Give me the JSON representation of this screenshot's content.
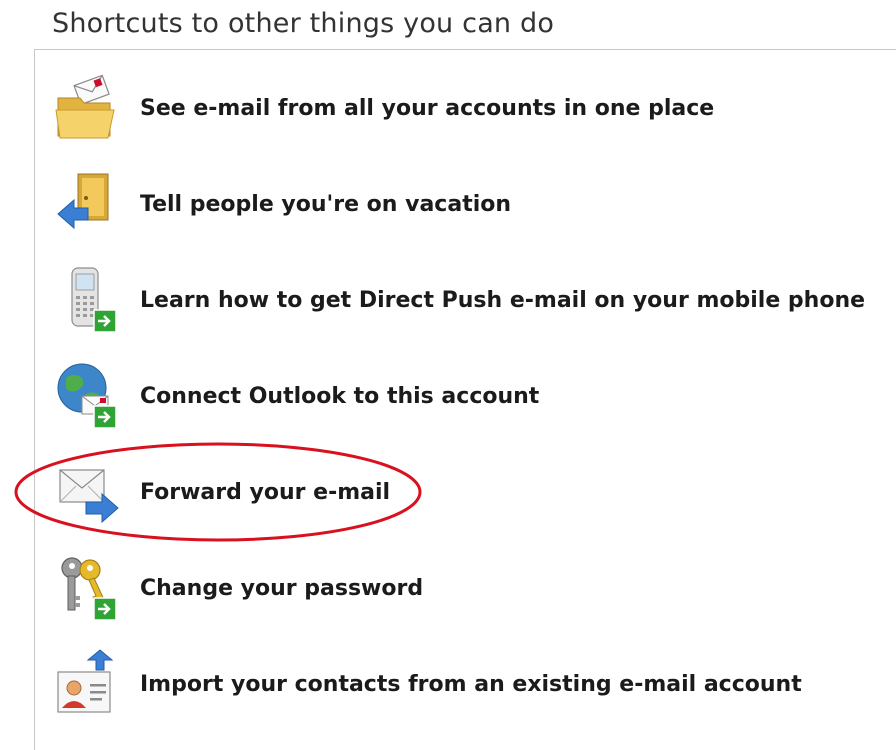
{
  "header": {
    "title": "Shortcuts to other things you can do"
  },
  "shortcuts": [
    {
      "label": "See e-mail from all your accounts in one place",
      "icon": "folder-mail-icon"
    },
    {
      "label": "Tell people you're on vacation",
      "icon": "vacation-door-arrow-icon"
    },
    {
      "label": "Learn how to get Direct Push e-mail on your mobile phone",
      "icon": "mobile-phone-icon"
    },
    {
      "label": "Connect Outlook to this account",
      "icon": "globe-mail-icon"
    },
    {
      "label": "Forward your e-mail",
      "icon": "envelope-forward-icon"
    },
    {
      "label": "Change your password",
      "icon": "keys-icon"
    },
    {
      "label": "Import your contacts from an existing e-mail account",
      "icon": "contact-card-import-icon"
    }
  ],
  "annotation": {
    "shape": "ellipse",
    "color": "#d9101e",
    "target": "Forward your e-mail"
  },
  "colors": {
    "link_text": "#1b1b1b",
    "heading_text": "#333333",
    "divider": "#c9c9c9",
    "arrow_blue": "#3b7fd4",
    "badge_green": "#2fa334"
  }
}
